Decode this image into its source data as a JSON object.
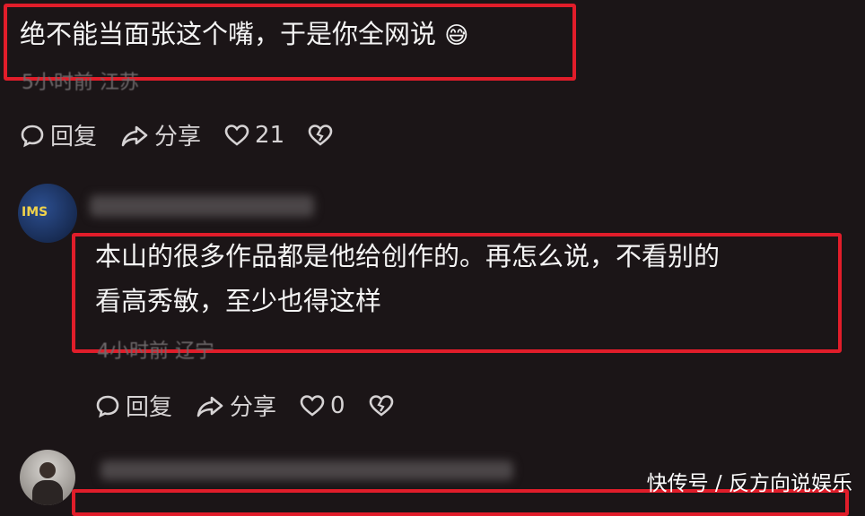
{
  "comments": [
    {
      "text": "绝不能当面张这个嘴，于是你全网说",
      "emoji": "😅",
      "meta": "5小时前 江苏",
      "reply_label": "回复",
      "share_label": "分享",
      "like_count": "21"
    },
    {
      "text_line1": "本山的很多作品都是他给创作的。再怎么说，不看别的",
      "text_line2": "看高秀敏，至少也得这样",
      "meta": "4小时前 辽宁",
      "reply_label": "回复",
      "share_label": "分享",
      "like_count": "0",
      "avatar_text": "IMS"
    }
  ],
  "watermark": "快传号 / 反方向说娱乐",
  "colors": {
    "highlight": "#e11d2a",
    "background": "#1b1517"
  }
}
